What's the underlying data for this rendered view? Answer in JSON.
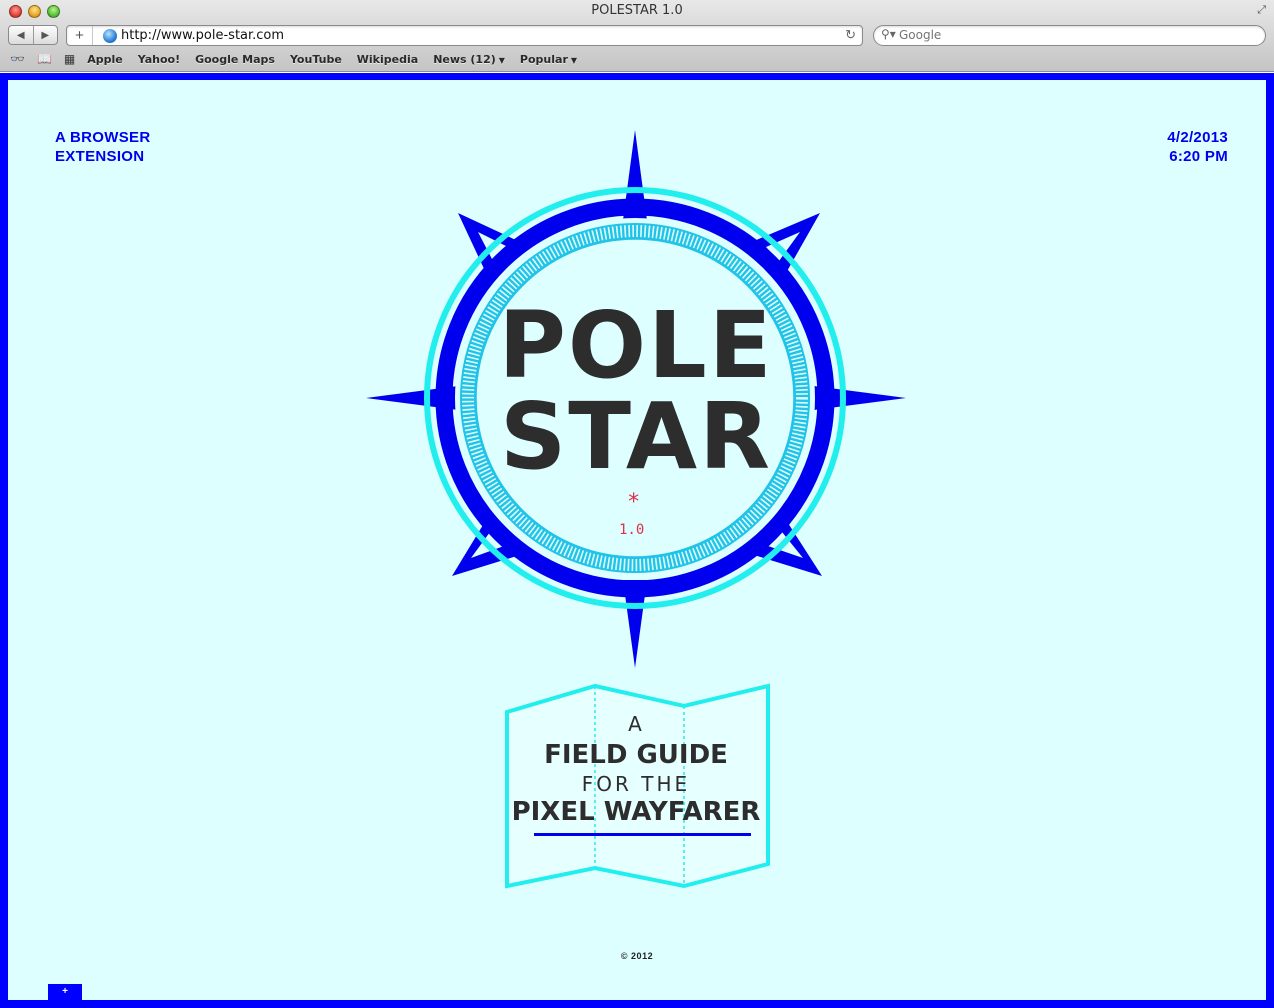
{
  "window": {
    "title": "POLESTAR 1.0"
  },
  "toolbar": {
    "back_icon": "back-arrow-icon",
    "forward_icon": "forward-arrow-icon",
    "add_icon": "plus-icon",
    "url": "http://www.pole-star.com",
    "reload_icon": "reload-icon",
    "search_placeholder": "Google"
  },
  "bookmarks": {
    "items": [
      {
        "label": "Apple"
      },
      {
        "label": "Yahoo!"
      },
      {
        "label": "Google Maps"
      },
      {
        "label": "YouTube"
      },
      {
        "label": "Wikipedia"
      },
      {
        "label": "News (12)"
      },
      {
        "label": "Popular"
      }
    ]
  },
  "page": {
    "top_left": {
      "line1": "A BROWSER",
      "line2": "EXTENSION"
    },
    "top_right": {
      "line1": "4/2/2013",
      "line2": "6:20 PM"
    },
    "logo": {
      "line1": "POLE",
      "line2": "STAR",
      "asterisk": "*",
      "version": "1.0"
    },
    "map_label": {
      "line1": "A",
      "line2": "FIELD GUIDE",
      "line3": "FOR THE",
      "line4": "PIXEL WAYFARER"
    },
    "copyright": "© 2012",
    "tab_label": "+"
  },
  "colors": {
    "frame_blue": "#0000ff",
    "page_bg": "#deffff",
    "cyan_ring": "#22eeee",
    "accent_red": "#e0304a",
    "text_dark": "#2d2d2d"
  }
}
